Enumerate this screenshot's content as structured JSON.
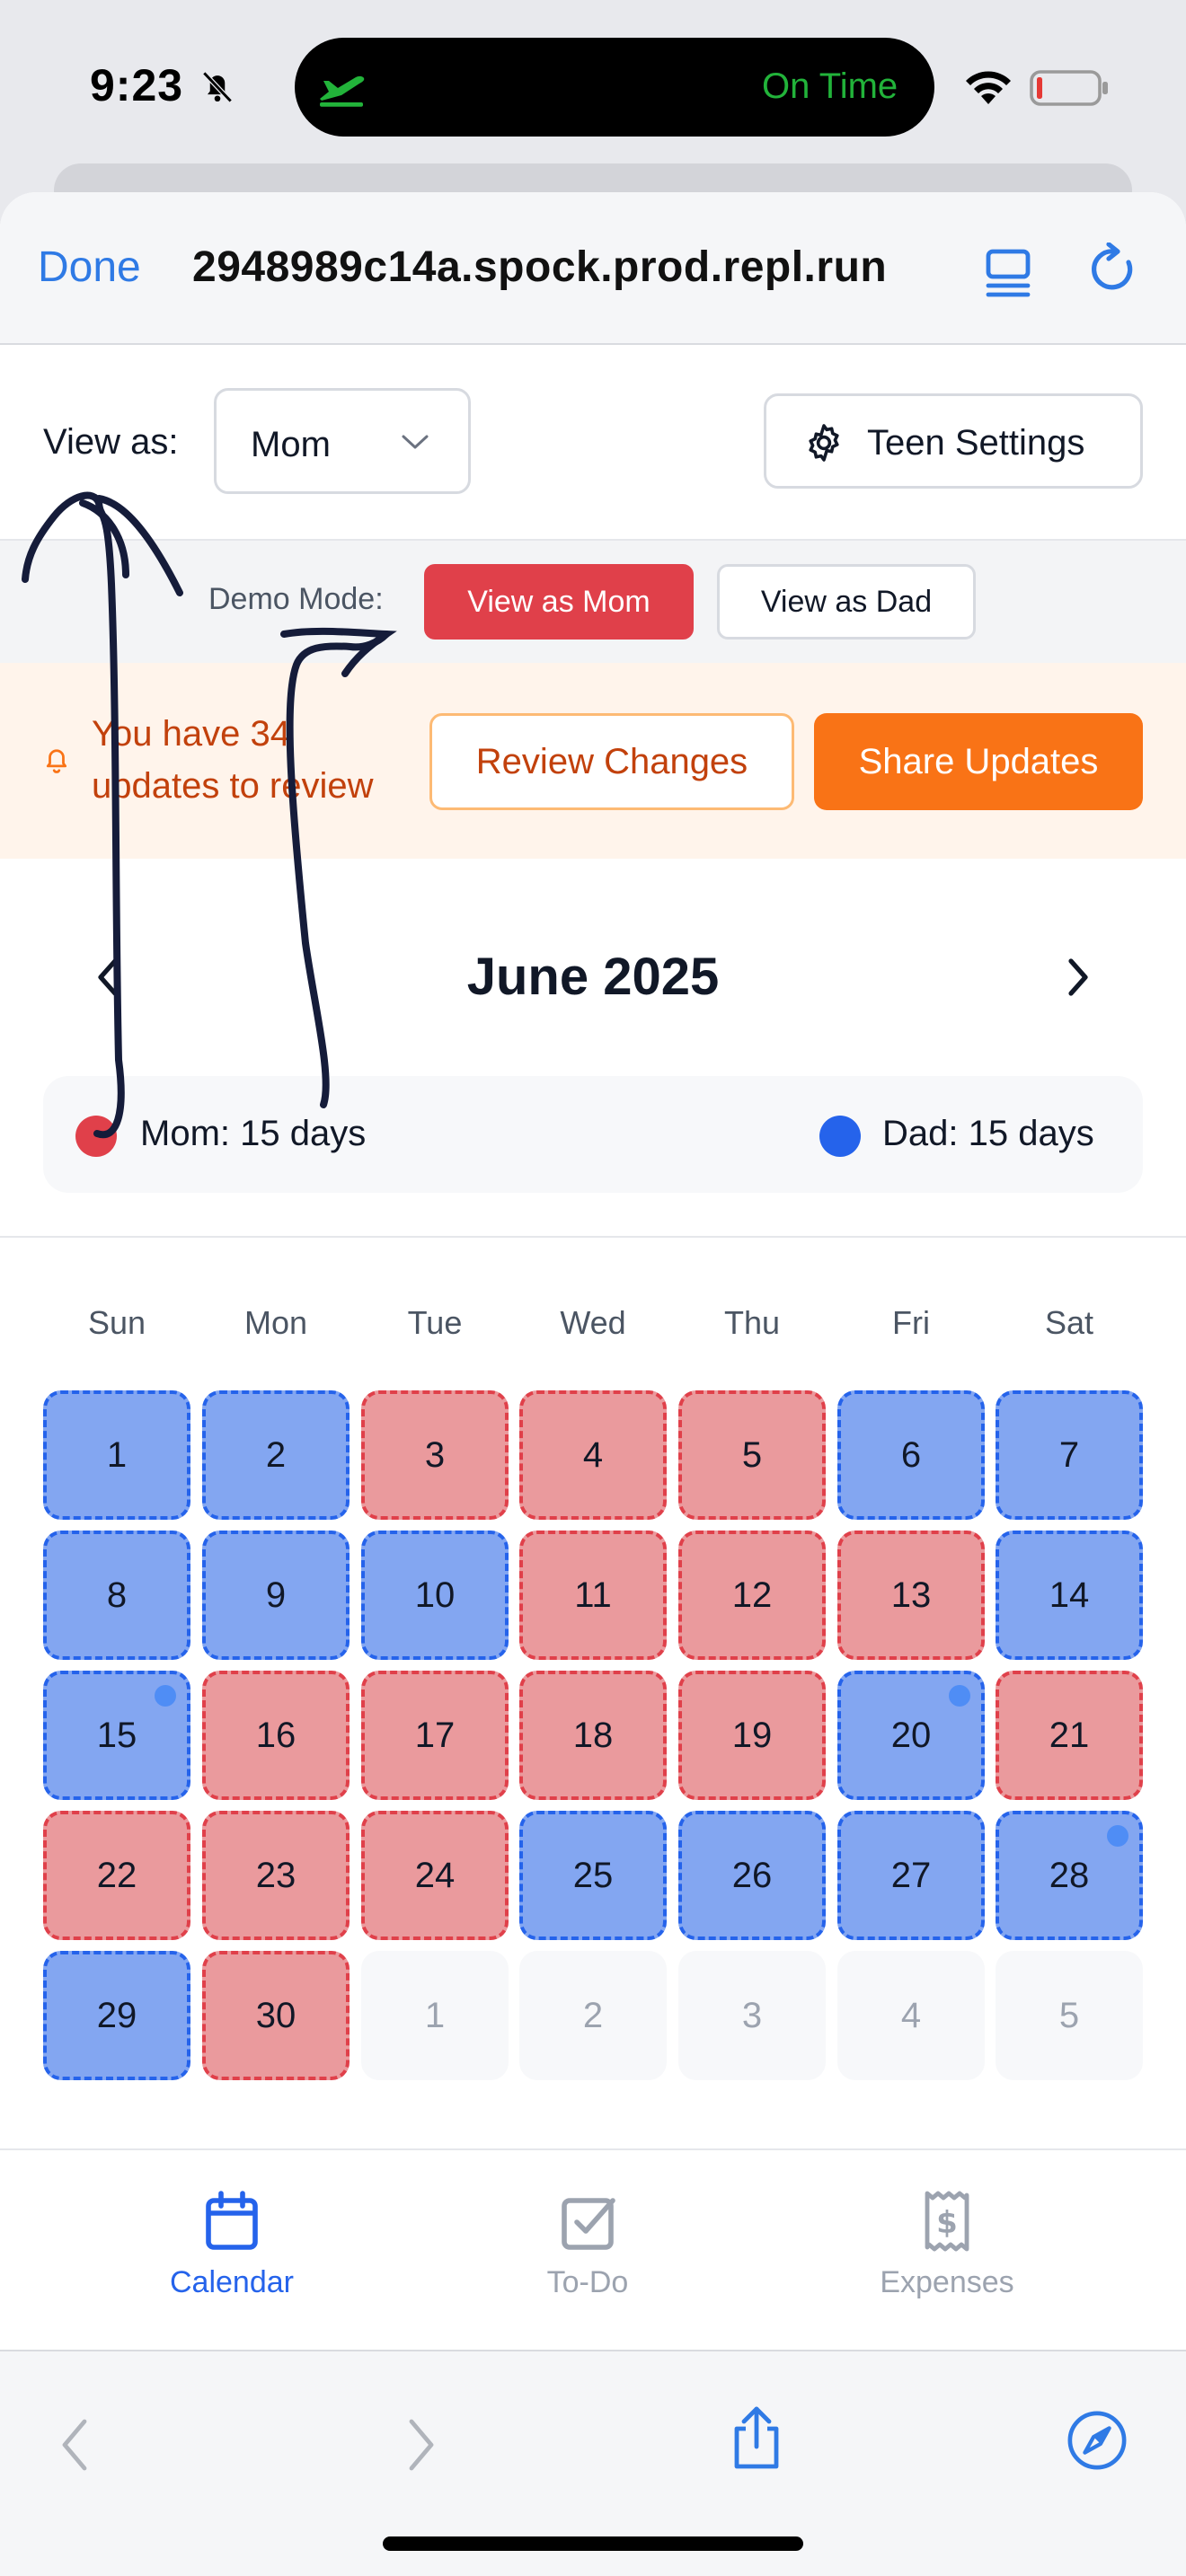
{
  "status_bar": {
    "time": "9:23",
    "live_activity_text": "On Time"
  },
  "browser": {
    "done_label": "Done",
    "url": "2948989c14a.spock.prod.repl.run"
  },
  "view_as": {
    "label": "View as:",
    "selected": "Mom",
    "settings_label": "Teen Settings"
  },
  "demo": {
    "label": "Demo Mode:",
    "view_mom": "View as Mom",
    "view_dad": "View as Dad"
  },
  "updates": {
    "message": "You have 34 updates to review",
    "review_label": "Review Changes",
    "share_label": "Share Updates"
  },
  "calendar": {
    "month_title": "June 2025",
    "mom_stat": "Mom: 15 days",
    "dad_stat": "Dad: 15 days",
    "weekdays": [
      "Sun",
      "Mon",
      "Tue",
      "Wed",
      "Thu",
      "Fri",
      "Sat"
    ],
    "days": [
      {
        "label": "1",
        "owner": "dad"
      },
      {
        "label": "2",
        "owner": "dad"
      },
      {
        "label": "3",
        "owner": "mom"
      },
      {
        "label": "4",
        "owner": "mom"
      },
      {
        "label": "5",
        "owner": "mom"
      },
      {
        "label": "6",
        "owner": "dad"
      },
      {
        "label": "7",
        "owner": "dad"
      },
      {
        "label": "8",
        "owner": "dad"
      },
      {
        "label": "9",
        "owner": "dad"
      },
      {
        "label": "10",
        "owner": "dad"
      },
      {
        "label": "11",
        "owner": "mom"
      },
      {
        "label": "12",
        "owner": "mom"
      },
      {
        "label": "13",
        "owner": "mom"
      },
      {
        "label": "14",
        "owner": "dad"
      },
      {
        "label": "15",
        "owner": "dad",
        "marker": true
      },
      {
        "label": "16",
        "owner": "mom"
      },
      {
        "label": "17",
        "owner": "mom"
      },
      {
        "label": "18",
        "owner": "mom"
      },
      {
        "label": "19",
        "owner": "mom"
      },
      {
        "label": "20",
        "owner": "dad",
        "marker": true
      },
      {
        "label": "21",
        "owner": "mom"
      },
      {
        "label": "22",
        "owner": "mom"
      },
      {
        "label": "23",
        "owner": "mom"
      },
      {
        "label": "24",
        "owner": "mom"
      },
      {
        "label": "25",
        "owner": "dad"
      },
      {
        "label": "26",
        "owner": "dad"
      },
      {
        "label": "27",
        "owner": "dad"
      },
      {
        "label": "28",
        "owner": "dad",
        "marker": true
      },
      {
        "label": "29",
        "owner": "dad"
      },
      {
        "label": "30",
        "owner": "mom"
      },
      {
        "label": "1",
        "owner": "other"
      },
      {
        "label": "2",
        "owner": "other"
      },
      {
        "label": "3",
        "owner": "other"
      },
      {
        "label": "4",
        "owner": "other"
      },
      {
        "label": "5",
        "owner": "other"
      }
    ]
  },
  "tabs": [
    {
      "label": "Calendar",
      "icon": "calendar-icon",
      "active": true
    },
    {
      "label": "To-Do",
      "icon": "checkbox-icon",
      "active": false
    },
    {
      "label": "Expenses",
      "icon": "receipt-icon",
      "active": false
    }
  ],
  "colors": {
    "mom": "#e0404a",
    "dad": "#2563eb",
    "accent_orange": "#f97316",
    "tab_active": "#2563eb",
    "tab_inactive": "#9ca3af"
  }
}
